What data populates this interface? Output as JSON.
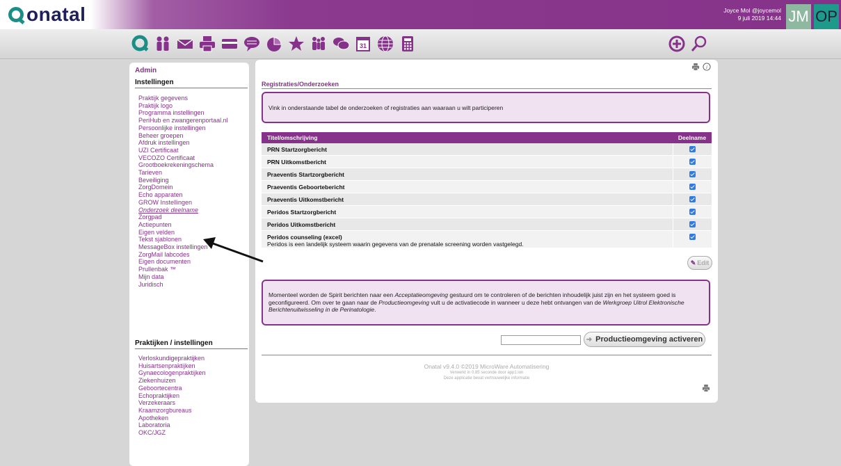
{
  "app": {
    "logo_text": "onatal",
    "logo_icon": "q-logo-icon"
  },
  "user": {
    "name": "Joyce Mol @joycemol",
    "datetime": "9 juli 2019 14:44",
    "avatar1": "JM",
    "avatar2": "OP"
  },
  "toolbar": {
    "icons": [
      "q-icon",
      "people-icon",
      "mail-icon",
      "printer-icon",
      "card-icon",
      "chat-bubble-icon",
      "pie-chart-icon",
      "star-icon",
      "group-icon",
      "chat-icon",
      "calendar-icon",
      "globe-icon",
      "calculator-icon"
    ],
    "calendar_day": "31",
    "right_icons": [
      "add-icon",
      "search-icon"
    ]
  },
  "sidebar": {
    "admin_label": "Admin",
    "section1": "Instellingen",
    "items": [
      "Praktijk gegevens",
      "Praktijk logo",
      "Programma instellingen",
      "PeriHub en zwangerenportaal.nl",
      "Persoonlijke instellingen",
      "Beheer groepen",
      "Afdruk instellingen",
      "UZI Certificaat",
      "VECOZO Certificaat",
      "Grootboekrekeningschema",
      "Tarieven",
      "Beveiliging",
      "ZorgDomein",
      "Echo apparaten",
      "GROW Instellingen",
      "Onderzoek deelname",
      "Zorgpad",
      "Actiepunten",
      "Eigen velden",
      "Tekst sjablonen",
      "MessageBox instellingen",
      "ZorgMail labcodes",
      "Eigen documenten",
      "Prullenbak ™",
      "Mijn data",
      "Juridisch"
    ],
    "active_item": "Onderzoek deelname",
    "section2": "Praktijken / instellingen",
    "items2": [
      "Verloskundigepraktijken",
      "Huisartsenpraktijken",
      "Gynaecologenpraktijken",
      "Ziekenhuizen",
      "Geboortecentra",
      "Echopraktijken",
      "Verzekeraars",
      "Kraamzorgbureaus",
      "Apotheken",
      "Laboratoria",
      "OKC/JGZ"
    ]
  },
  "main": {
    "title": "Registraties/Onderzoeken",
    "intro": "Vink in onderstaande tabel de onderzoeken of registraties aan waaraan u wilt participeren",
    "table": {
      "col_title": "Titel/omschrijving",
      "col_deelname": "Deelname",
      "rows": [
        {
          "title": "PRN Startzorgbericht",
          "desc": "",
          "checked": true
        },
        {
          "title": "PRN Uitkomstbericht",
          "desc": "",
          "checked": true
        },
        {
          "title": "Praeventis Startzorgbericht",
          "desc": "",
          "checked": true
        },
        {
          "title": "Praeventis Geboortebericht",
          "desc": "",
          "checked": true
        },
        {
          "title": "Praeventis Uitkomstbericht",
          "desc": "",
          "checked": true
        },
        {
          "title": "Peridos Startzorgbericht",
          "desc": "",
          "checked": true
        },
        {
          "title": "Peridos Uitkomstbericht",
          "desc": "",
          "checked": true
        },
        {
          "title": "Peridos counseling (excel)",
          "desc": "Peridos is een landelijk systeem waarin gegevens van de prenatale screening worden vastgelegd.",
          "checked": true
        }
      ]
    },
    "edit_label": "Edit",
    "notice": {
      "p1": "Momenteel worden de Spirit berichten naar een ",
      "em1": "Acceptatieomgeving",
      "p2": " gestuurd om te controleren of de berichten inhoudelijk juist zijn en het systeem goed is geconfigureerd. Om over te gaan naar de ",
      "em2": "Productieomgeving",
      "p3": " vult u de activatiecode in wanneer u deze hebt ontvangen van de ",
      "em3": "Werkgroep Uitrol Elektronische Berichtenuitwisseling in de Perinatologie",
      "p4": "."
    },
    "activate_label": "Productieomgeving activeren",
    "activate_value": ""
  },
  "footer": {
    "line1": "Onatal v9.4.0 ©2019 MicroWare Automatisering",
    "line2": "Verwerkt in 0.85 seconde door app1:ion",
    "line3": "Deze applicatie bevat vertrouwelijke informatie"
  },
  "colors": {
    "brand": "#86328a",
    "accent": "#1b8e86",
    "checkbox": "#2f7ae5"
  }
}
